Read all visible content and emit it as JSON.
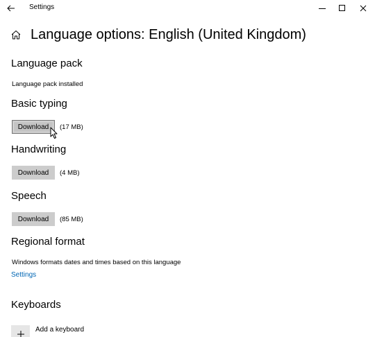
{
  "window": {
    "title": "Settings"
  },
  "header": {
    "title": "Language options: English (United Kingdom)"
  },
  "language_pack": {
    "heading": "Language pack",
    "status": "Language pack installed"
  },
  "basic_typing": {
    "heading": "Basic typing",
    "button_label": "Download",
    "size": "(17 MB)"
  },
  "handwriting": {
    "heading": "Handwriting",
    "button_label": "Download",
    "size": "(4 MB)"
  },
  "speech": {
    "heading": "Speech",
    "button_label": "Download",
    "size": "(85 MB)"
  },
  "regional_format": {
    "heading": "Regional format",
    "description": "Windows formats dates and times based on this language",
    "link": "Settings"
  },
  "keyboards": {
    "heading": "Keyboards",
    "add_label": "Add a keyboard"
  },
  "icons": {
    "back": "back-arrow-icon",
    "home": "home-icon",
    "minimize": "minimize-icon",
    "maximize": "maximize-icon",
    "close": "close-icon",
    "add": "plus-icon",
    "cursor": "mouse-pointer-icon"
  },
  "colors": {
    "accent_link": "#0066b4",
    "button_bg": "#cccccc"
  }
}
